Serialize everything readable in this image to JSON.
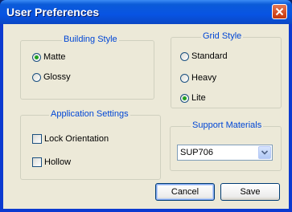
{
  "window": {
    "title": "User Preferences"
  },
  "building_style": {
    "title": "Building Style",
    "options": [
      {
        "label": "Matte",
        "checked": true
      },
      {
        "label": "Glossy",
        "checked": false
      }
    ]
  },
  "grid_style": {
    "title": "Grid Style",
    "options": [
      {
        "label": "Standard",
        "checked": false
      },
      {
        "label": "Heavy",
        "checked": false
      },
      {
        "label": "Lite",
        "checked": true
      }
    ]
  },
  "application_settings": {
    "title": "Application Settings",
    "options": [
      {
        "label": "Lock Orientation",
        "checked": false
      },
      {
        "label": "Hollow",
        "checked": false
      }
    ]
  },
  "support_materials": {
    "title": "Support Materials",
    "selected": "SUP706"
  },
  "buttons": {
    "cancel": "Cancel",
    "save": "Save"
  },
  "icons": {
    "close": "close-icon",
    "dropdown": "chevron-down-icon"
  }
}
